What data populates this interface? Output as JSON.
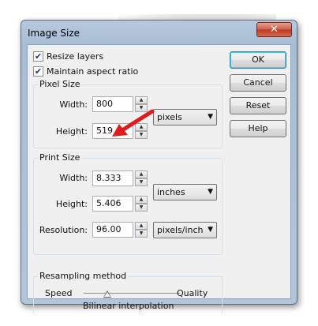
{
  "window": {
    "title": "Image Size",
    "close_label": "✕"
  },
  "options": {
    "resize_layers": {
      "label": "Resize layers",
      "checked": true
    },
    "maintain_aspect": {
      "label": "Maintain aspect ratio",
      "checked": true
    }
  },
  "pixel_size": {
    "title": "Pixel Size",
    "width_label": "Width:",
    "width_value": "800",
    "height_label": "Height:",
    "height_value": "519",
    "unit": "pixels"
  },
  "print_size": {
    "title": "Print Size",
    "width_label": "Width:",
    "width_value": "8.333",
    "height_label": "Height:",
    "height_value": "5.406",
    "unit": "inches",
    "resolution_label": "Resolution:",
    "resolution_value": "96.00",
    "resolution_unit": "pixels/inch"
  },
  "resampling": {
    "title": "Resampling method",
    "left_label": "Speed",
    "right_label": "Quality",
    "method": "Bilinear interpolation"
  },
  "buttons": {
    "ok": "OK",
    "cancel": "Cancel",
    "reset": "Reset",
    "help": "Help"
  },
  "colors": {
    "arrow": "#e01b1b",
    "title_bar": "#b7c9dd"
  }
}
